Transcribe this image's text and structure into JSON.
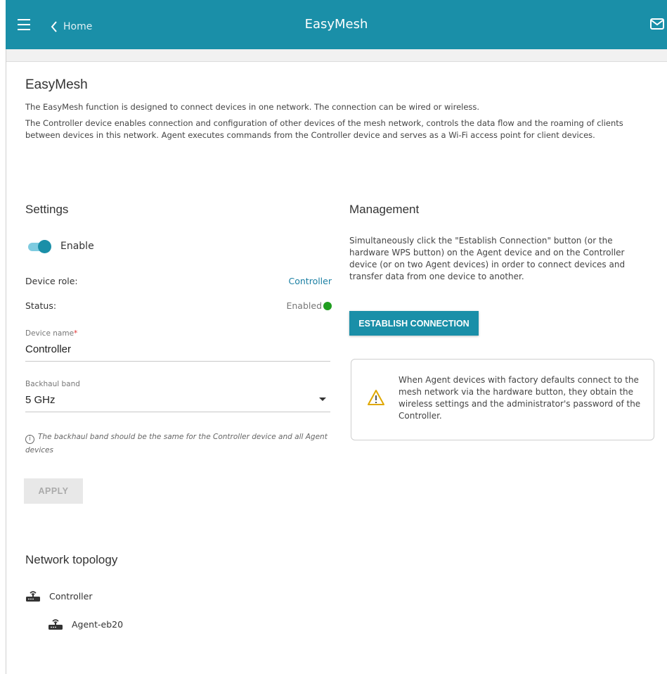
{
  "header": {
    "back_label": "Home",
    "title": "EasyMesh",
    "accent_color": "#1a8fa8"
  },
  "page": {
    "title": "EasyMesh",
    "description_1": "The EasyMesh function is designed to connect devices in one network. The connection can be wired or wireless.",
    "description_2": "The Controller device enables connection and configuration of other devices of the mesh network, controls the data flow and the roaming of clients between devices in this network. Agent executes commands from the Controller device and serves as a Wi-Fi access point for client devices."
  },
  "settings": {
    "title": "Settings",
    "enable_label": "Enable",
    "enabled": true,
    "device_role_label": "Device role:",
    "device_role_value": "Controller",
    "status_label": "Status:",
    "status_value": "Enabled",
    "status_color": "#1f9d1f",
    "device_name_label": "Device name",
    "device_name_required": "*",
    "device_name_value": "Controller",
    "backhaul_label": "Backhaul band",
    "backhaul_value": "5 GHz",
    "hint": "The backhaul band should be the same for the Controller device and all Agent devices",
    "apply_label": "APPLY"
  },
  "management": {
    "title": "Management",
    "text": "Simultaneously click the \"Establish Connection\" button (or the hardware WPS button) on the Agent device and on the Controller device (or on two Agent devices) in order to connect devices and transfer data from one device to another.",
    "establish_label": "ESTABLISH CONNECTION",
    "notice": "When Agent devices with factory defaults connect to the mesh network via the hardware button, they obtain the wireless settings and the administrator's password of the Controller."
  },
  "topology": {
    "title": "Network topology",
    "nodes": [
      {
        "label": "Controller",
        "icon": "router-icon"
      },
      {
        "label": "Agent-eb20",
        "icon": "router-icon"
      }
    ]
  }
}
